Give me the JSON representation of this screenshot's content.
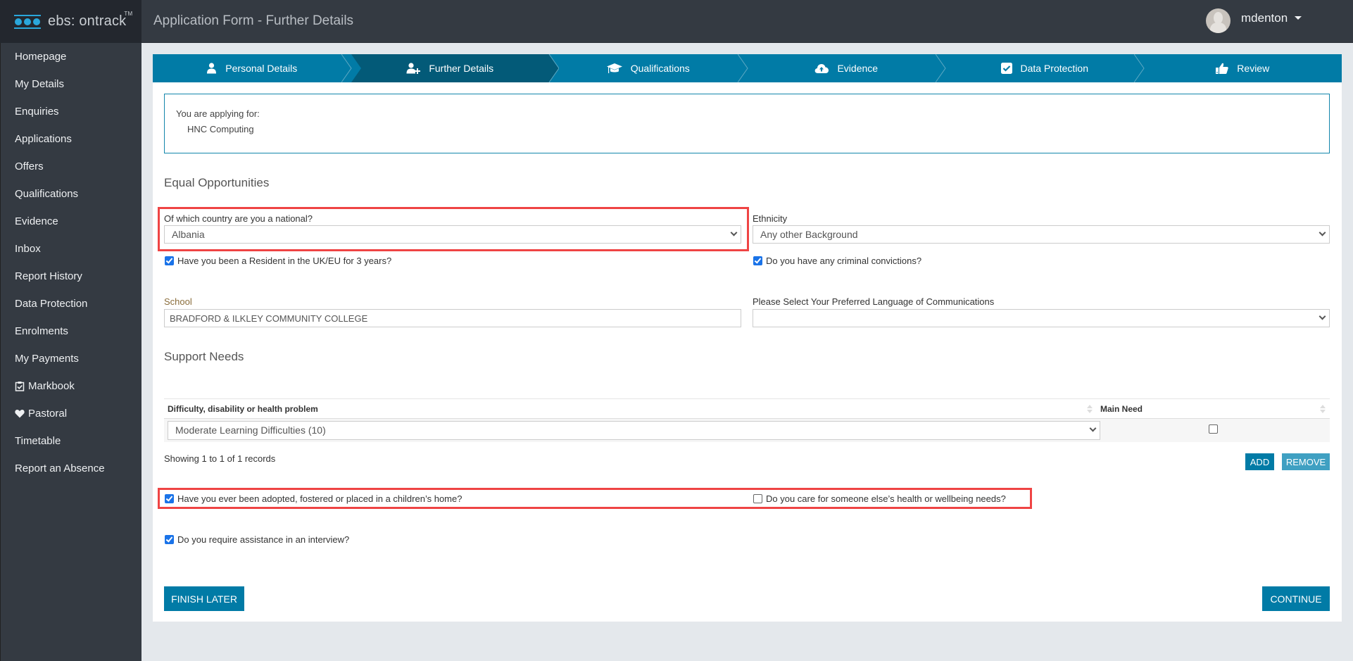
{
  "header": {
    "brand": "ebs: ontrack",
    "brand_tm": "TM",
    "title": "Application Form - Further Details",
    "username": "mdenton"
  },
  "sidebar": {
    "items": [
      {
        "label": "Homepage",
        "icon": null
      },
      {
        "label": "My Details",
        "icon": null
      },
      {
        "label": "Enquiries",
        "icon": null
      },
      {
        "label": "Applications",
        "icon": null
      },
      {
        "label": "Offers",
        "icon": null
      },
      {
        "label": "Qualifications",
        "icon": null
      },
      {
        "label": "Evidence",
        "icon": null
      },
      {
        "label": "Inbox",
        "icon": null
      },
      {
        "label": "Report History",
        "icon": null
      },
      {
        "label": "Data Protection",
        "icon": null
      },
      {
        "label": "Enrolments",
        "icon": null
      },
      {
        "label": "My Payments",
        "icon": null
      },
      {
        "label": "Markbook",
        "icon": "clipboard-check-icon"
      },
      {
        "label": "Pastoral",
        "icon": "heart-icon"
      },
      {
        "label": "Timetable",
        "icon": null
      },
      {
        "label": "Report an Absence",
        "icon": null
      }
    ]
  },
  "wizard": {
    "steps": [
      {
        "label": "Personal Details",
        "icon": "user-icon",
        "active": false
      },
      {
        "label": "Further Details",
        "icon": "user-plus-icon",
        "active": true
      },
      {
        "label": "Qualifications",
        "icon": "graduation-cap-icon",
        "active": false
      },
      {
        "label": "Evidence",
        "icon": "cloud-upload-icon",
        "active": false
      },
      {
        "label": "Data Protection",
        "icon": "check-square-icon",
        "active": false
      },
      {
        "label": "Review",
        "icon": "thumbs-up-icon",
        "active": false
      }
    ]
  },
  "applying": {
    "label": "You are applying for:",
    "course": "HNC Computing"
  },
  "equal_opportunities": {
    "title": "Equal Opportunities",
    "nationality": {
      "label": "Of which country are you a national?",
      "value": "Albania"
    },
    "ethnicity": {
      "label": "Ethnicity",
      "value": "Any other Background"
    },
    "resident": {
      "label": "Have you been a Resident in the UK/EU for 3 years?",
      "checked": true
    },
    "convictions": {
      "label": "Do you have any criminal convictions?",
      "checked": true
    },
    "school": {
      "label": "School",
      "value": "BRADFORD & ILKLEY COMMUNITY COLLEGE"
    },
    "language": {
      "label": "Please Select Your Preferred Language of Communications",
      "value": ""
    }
  },
  "support_needs": {
    "title": "Support Needs",
    "columns": [
      "Difficulty, disability or health problem",
      "Main Need"
    ],
    "rows": [
      {
        "difficulty": "Moderate Learning Difficulties (10)",
        "main_need": false
      }
    ],
    "records_text": "Showing 1 to 1 of 1 records",
    "add_label": "ADD",
    "remove_label": "REMOVE"
  },
  "questions": {
    "adopted": {
      "label": "Have you ever been adopted, fostered or placed in a children’s home?",
      "checked": true
    },
    "carer": {
      "label": "Do you care for someone else’s health or wellbeing needs?",
      "checked": false
    },
    "interview": {
      "label": "Do you require assistance in an interview?",
      "checked": true
    }
  },
  "footer": {
    "finish_later_label": "FINISH LATER",
    "continue_label": "CONTINUE"
  },
  "colors": {
    "primary": "#017ba6",
    "active_step": "#035a78",
    "highlight": "#ef4444",
    "sidebar": "#343a42"
  }
}
